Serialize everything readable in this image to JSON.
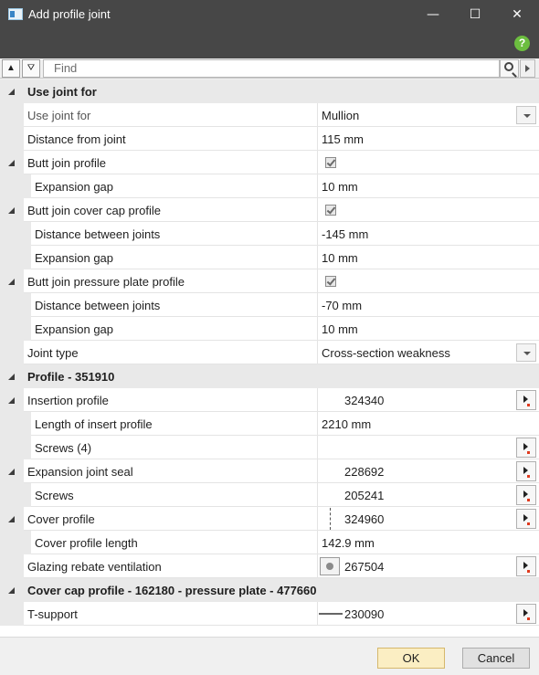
{
  "window": {
    "title": "Add profile joint",
    "minimize": "—",
    "maximize": "☐",
    "close": "✕"
  },
  "help": {
    "label": "?"
  },
  "toolbar": {
    "collapse_glyph": "▲",
    "filter_glyph": "⛛",
    "search_placeholder": "Find"
  },
  "rows": [
    {
      "name": "Use joint for",
      "section": true
    },
    {
      "name": "Use joint for",
      "value": "Mullion",
      "control": "dropdown",
      "dim": true
    },
    {
      "name": "Distance from joint",
      "value": "115 mm"
    },
    {
      "name": "Butt join profile",
      "value": "",
      "control": "checkbox",
      "checked": true,
      "group": true
    },
    {
      "name": "Expansion gap",
      "value": "10 mm",
      "indent": true
    },
    {
      "name": "Butt join cover cap profile",
      "value": "",
      "control": "checkbox",
      "checked": true,
      "group": true
    },
    {
      "name": "Distance between joints",
      "value": "-145 mm",
      "indent": true
    },
    {
      "name": "Expansion gap",
      "value": "10 mm",
      "indent": true
    },
    {
      "name": "Butt join pressure plate profile",
      "value": "",
      "control": "checkbox",
      "checked": true,
      "group": true
    },
    {
      "name": "Distance between joints",
      "value": "-70 mm",
      "indent": true
    },
    {
      "name": "Expansion gap",
      "value": "10 mm",
      "indent": true
    },
    {
      "name": "Joint type",
      "value": "Cross-section weakness",
      "control": "dropdown"
    },
    {
      "name": "Profile - 351910",
      "section": true
    },
    {
      "name": "Insertion profile",
      "value": "324340",
      "control": "picker",
      "group": true
    },
    {
      "name": "Length of insert profile",
      "value": "2210 mm",
      "indent": true
    },
    {
      "name": "Screws (4)",
      "value": "",
      "control": "picker",
      "indent": true
    },
    {
      "name": "Expansion joint seal",
      "value": "228692",
      "control": "picker",
      "group": true
    },
    {
      "name": "Screws",
      "value": "205241",
      "control": "picker",
      "indent": true
    },
    {
      "name": "Cover profile",
      "value": "324960",
      "control": "picker",
      "group": true,
      "thumb": "dash"
    },
    {
      "name": "Cover profile length",
      "value": "142.9 mm",
      "indent": true
    },
    {
      "name": "Glazing rebate ventilation",
      "value": "267504",
      "control": "picker",
      "thumb": "vent"
    },
    {
      "name": "Cover cap profile - 162180 - pressure plate - 477660",
      "section": true
    },
    {
      "name": "T-support",
      "value": "230090",
      "control": "picker",
      "thumb": "line"
    }
  ],
  "footer": {
    "ok_label": "OK",
    "cancel_label": "Cancel"
  }
}
